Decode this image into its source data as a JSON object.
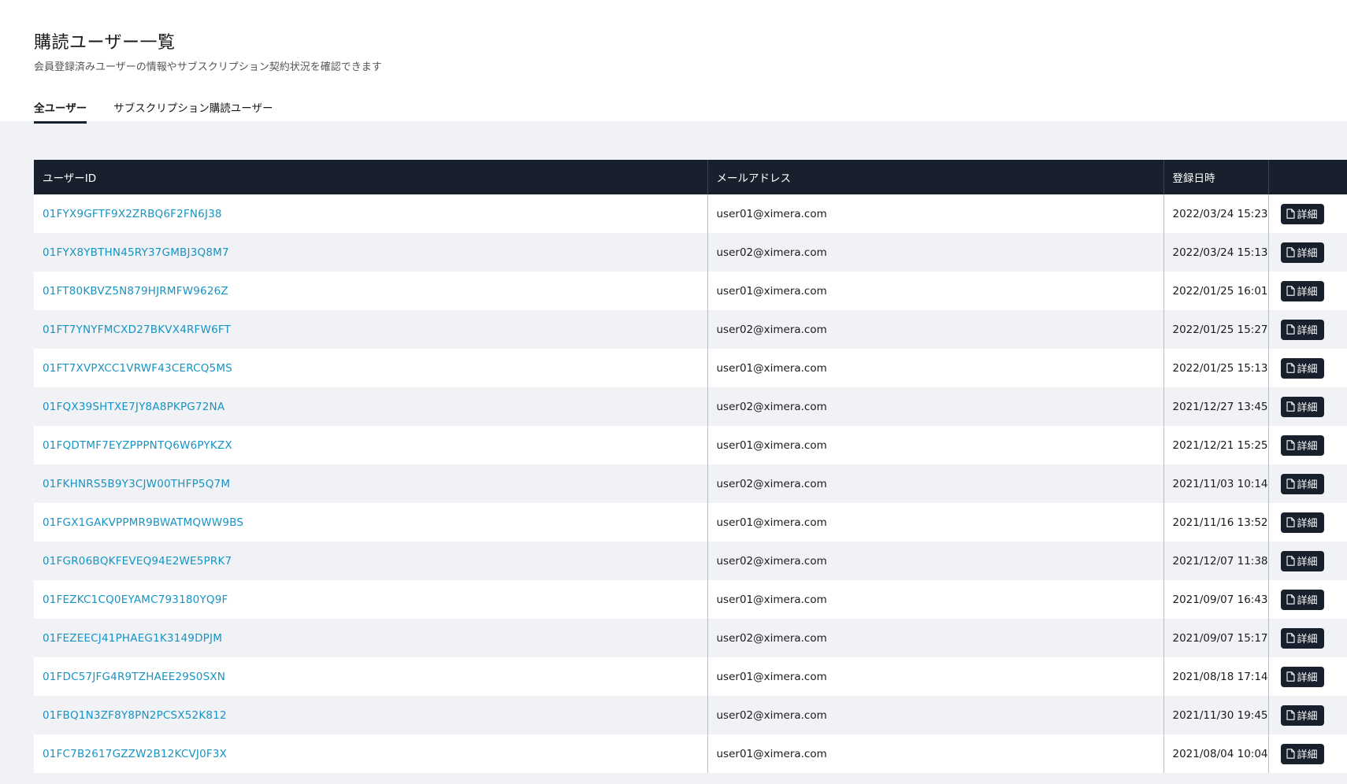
{
  "header": {
    "title": "購読ユーザー一覧",
    "subtitle": "会員登録済みユーザーの情報やサブスクリプション契約状況を確認できます"
  },
  "tabs": [
    {
      "label": "全ユーザー",
      "active": true
    },
    {
      "label": "サブスクリプション購読ユーザー",
      "active": false
    }
  ],
  "table": {
    "columns": [
      "ユーザーID",
      "メールアドレス",
      "登録日時",
      ""
    ],
    "detail_label": "詳細",
    "rows": [
      {
        "id": "01FYX9GFTF9X2ZRBQ6F2FN6J38",
        "email": "user01@ximera.com",
        "date": "2022/03/24 15:23"
      },
      {
        "id": "01FYX8YBTHN45RY37GMBJ3Q8M7",
        "email": "user02@ximera.com",
        "date": "2022/03/24 15:13"
      },
      {
        "id": "01FT80KBVZ5N879HJRMFW9626Z",
        "email": "user01@ximera.com",
        "date": "2022/01/25 16:01"
      },
      {
        "id": "01FT7YNYFMCXD27BKVX4RFW6FT",
        "email": "user02@ximera.com",
        "date": "2022/01/25 15:27"
      },
      {
        "id": "01FT7XVPXCC1VRWF43CERCQ5MS",
        "email": "user01@ximera.com",
        "date": "2022/01/25 15:13"
      },
      {
        "id": "01FQX39SHTXE7JY8A8PKPG72NA",
        "email": "user02@ximera.com",
        "date": "2021/12/27 13:45"
      },
      {
        "id": "01FQDTMF7EYZPPPNTQ6W6PYKZX",
        "email": "user01@ximera.com",
        "date": "2021/12/21 15:25"
      },
      {
        "id": "01FKHNRS5B9Y3CJW00THFP5Q7M",
        "email": "user02@ximera.com",
        "date": "2021/11/03 10:14"
      },
      {
        "id": "01FGX1GAKVPPMR9BWATMQWW9BS",
        "email": "user01@ximera.com",
        "date": "2021/11/16 13:52"
      },
      {
        "id": "01FGR06BQKFEVEQ94E2WE5PRK7",
        "email": "user02@ximera.com",
        "date": "2021/12/07 11:38"
      },
      {
        "id": "01FEZKC1CQ0EYAMC793180YQ9F",
        "email": "user01@ximera.com",
        "date": "2021/09/07 16:43"
      },
      {
        "id": "01FEZEECJ41PHAEG1K3149DPJM",
        "email": "user02@ximera.com",
        "date": "2021/09/07 15:17"
      },
      {
        "id": "01FDC57JFG4R9TZHAEE29S0SXN",
        "email": "user01@ximera.com",
        "date": "2021/08/18 17:14"
      },
      {
        "id": "01FBQ1N3ZF8Y8PN2PCSX52K812",
        "email": "user02@ximera.com",
        "date": "2021/11/30 19:45"
      },
      {
        "id": "01FC7B2617GZZW2B12KCVJ0F3X",
        "email": "user01@ximera.com",
        "date": "2021/08/04 10:04"
      }
    ]
  }
}
